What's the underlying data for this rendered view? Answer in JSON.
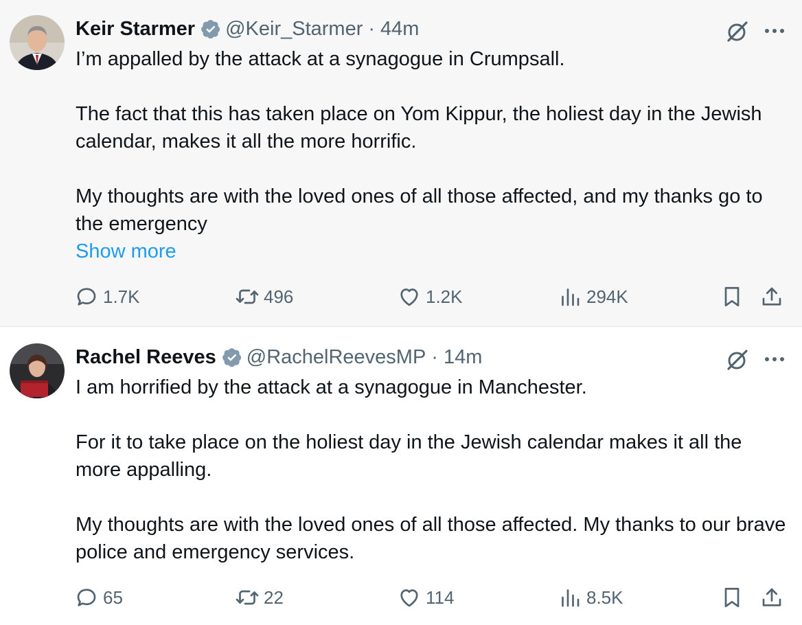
{
  "tweets": [
    {
      "author": {
        "name": "Keir Starmer",
        "handle": "@Keir_Starmer",
        "verified": true
      },
      "time": "44m",
      "separator": "·",
      "paragraphs": [
        "I’m appalled by the attack at a synagogue in Crumpsall.",
        "The fact that this has taken place on Yom Kippur, the holiest day in the Jewish calendar, makes it all the more horrific.",
        "My thoughts are with the loved ones of all those affected, and my thanks go to the emergency"
      ],
      "show_more": "Show more",
      "stats": {
        "replies": "1.7K",
        "reposts": "496",
        "likes": "1.2K",
        "views": "294K"
      }
    },
    {
      "author": {
        "name": "Rachel Reeves",
        "handle": "@RachelReevesMP",
        "verified": true
      },
      "time": "14m",
      "separator": "·",
      "paragraphs": [
        "I am horrified by the attack at a synagogue in Manchester.",
        "For it to take place on the holiest day in the Jewish calendar makes it all the more appalling.",
        "My thoughts are with the loved ones of all those affected. My thanks to our brave police and emergency services."
      ],
      "stats": {
        "replies": "65",
        "reposts": "22",
        "likes": "114",
        "views": "8.5K"
      }
    }
  ],
  "colors": {
    "text": "#0f1419",
    "muted": "#536471",
    "link": "#1d9bf0",
    "badge": "#829aab"
  },
  "icons": [
    "verified-badge-icon",
    "grok-icon",
    "more-icon",
    "reply-icon",
    "repost-icon",
    "like-icon",
    "views-icon",
    "bookmark-icon",
    "share-icon"
  ]
}
